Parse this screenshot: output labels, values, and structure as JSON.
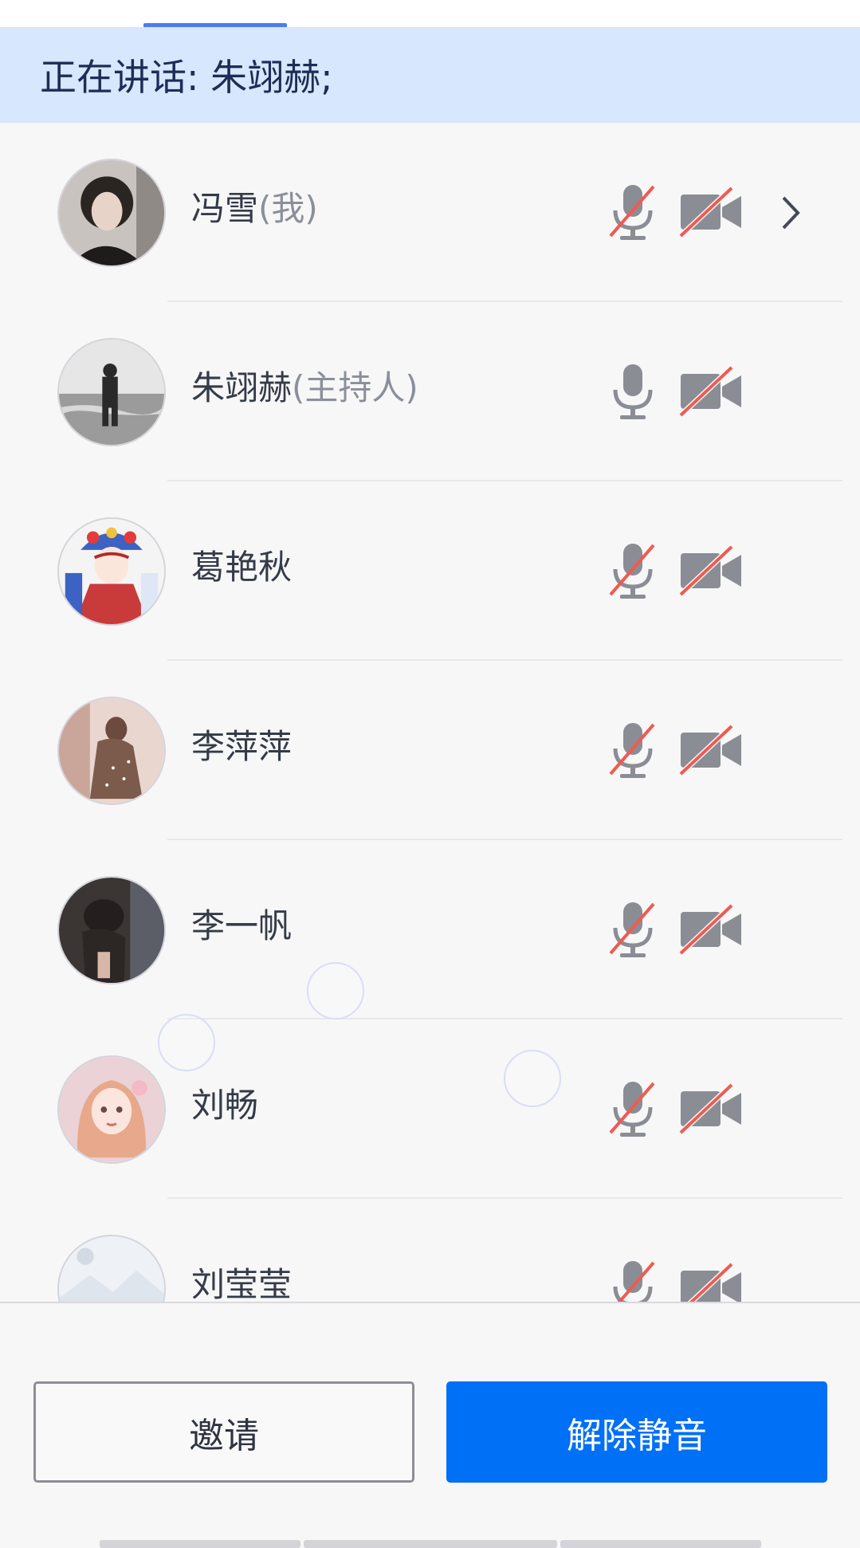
{
  "speaking_banner": {
    "text": "正在讲话: 朱翊赫;"
  },
  "participants": [
    {
      "name": "冯雪",
      "role": "(我)",
      "mic_muted": true,
      "camera_off": true,
      "has_chevron": true,
      "avatar": "short-haired-girl-photo"
    },
    {
      "name": "朱翊赫",
      "role": "(主持人)",
      "mic_muted": false,
      "camera_off": true,
      "has_chevron": false,
      "avatar": "person-on-beach-photo"
    },
    {
      "name": "葛艳秋",
      "role": "",
      "mic_muted": true,
      "camera_off": true,
      "has_chevron": false,
      "avatar": "peking-opera-illustration"
    },
    {
      "name": "李萍萍",
      "role": "",
      "mic_muted": true,
      "camera_off": true,
      "has_chevron": false,
      "avatar": "dancer-photo"
    },
    {
      "name": "李一帆",
      "role": "",
      "mic_muted": true,
      "camera_off": true,
      "has_chevron": false,
      "avatar": "dark-photo"
    },
    {
      "name": "刘畅",
      "role": "",
      "mic_muted": true,
      "camera_off": true,
      "has_chevron": false,
      "avatar": "pink-hair-girl-illustration"
    },
    {
      "name": "刘莹莹",
      "role": "",
      "mic_muted": true,
      "camera_off": true,
      "has_chevron": false,
      "avatar": "default-image-placeholder"
    }
  ],
  "buttons": {
    "invite": "邀请",
    "unmute": "解除静音"
  },
  "icons": {
    "mic": "microphone-icon",
    "mic_muted": "microphone-muted-icon",
    "camera_off": "camera-off-icon",
    "chevron": "chevron-right-icon"
  },
  "colors": {
    "primary": "#0070f7",
    "banner_bg": "#d7e7fd",
    "mute_slash": "#ee5b52",
    "icon_gray": "#8a8d94"
  }
}
